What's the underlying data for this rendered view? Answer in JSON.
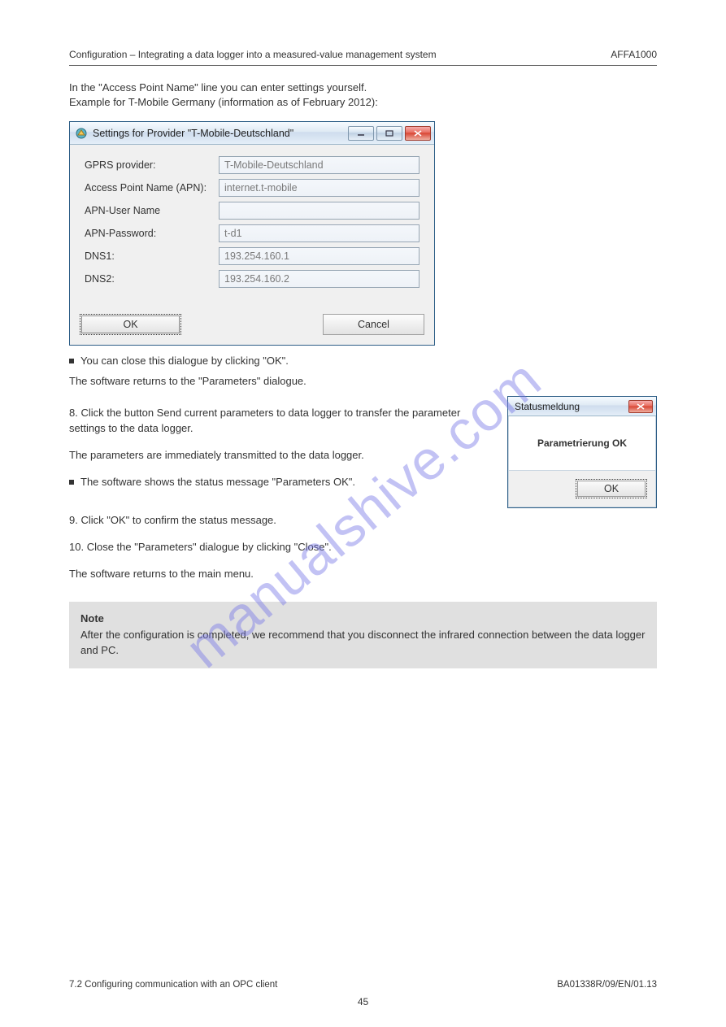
{
  "header": {
    "section_path": "Configuration – Integrating a data logger into a measured-value management system",
    "product": "AFFA1000"
  },
  "intro": {
    "line1": "In the \"Access Point Name\" line you can enter settings yourself.",
    "line2": "Example for T-Mobile Germany (information as of February 2012):"
  },
  "settings_dialog": {
    "title": "Settings for Provider \"T-Mobile-Deutschland\"",
    "fields": {
      "gprs_provider_label": "GPRS provider:",
      "gprs_provider_value": "T-Mobile-Deutschland",
      "apn_label": "Access Point Name (APN):",
      "apn_value": "internet.t-mobile",
      "apn_user_label": "APN-User Name",
      "apn_user_value": "",
      "apn_password_label": "APN-Password:",
      "apn_password_value": "t-d1",
      "dns1_label": "DNS1:",
      "dns1_value": "193.254.160.1",
      "dns2_label": "DNS2:",
      "dns2_value": "193.254.160.2"
    },
    "ok_label": "OK",
    "cancel_label": "Cancel"
  },
  "post_dialog": {
    "bullet_finish": "You can close this dialogue by clicking \"OK\".",
    "para_returns": "The software returns to the \"Parameters\" dialogue.",
    "section_num": "8.",
    "section_text": "Click the button Send current parameters to data logger to transfer the parameter settings to the data logger.",
    "para_immediately": "The parameters are immediately transmitted to the data logger.",
    "bullet_status": "The software shows the status message \"Parameters OK\"."
  },
  "status_dialog": {
    "title": "Statusmeldung",
    "message": "Parametrierung OK",
    "ok_label": "OK"
  },
  "after_status": {
    "nine": "9.",
    "nine_text": "Click \"OK\" to confirm the status message.",
    "ten": "10.",
    "ten_text": "Close the \"Parameters\" dialogue by clicking \"Close\".",
    "return_para": "The software returns to the main menu."
  },
  "note": {
    "head": "Note",
    "body": "After the configuration is completed, we recommend that you disconnect the infrared connection between the data logger and PC."
  },
  "footer": {
    "doc_left": "7.2 Configuring communication with an OPC client",
    "doc_id": "BA01338R/09/EN/01.13",
    "page_number": "45"
  },
  "watermark": "manualshive.com"
}
